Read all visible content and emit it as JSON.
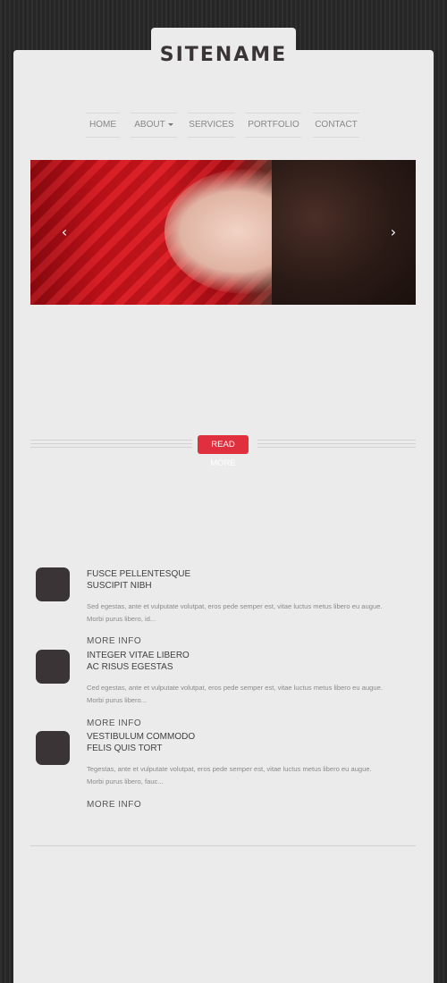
{
  "site": {
    "name": "SITENAME"
  },
  "nav": {
    "items": [
      {
        "label": "HOME"
      },
      {
        "label": "ABOUT"
      },
      {
        "label": "SERVICES"
      },
      {
        "label": "PORTFOLIO"
      },
      {
        "label": "CONTACT"
      }
    ]
  },
  "slider": {
    "prev_icon": "‹",
    "next_icon": "›"
  },
  "cta": {
    "label": "READ MORE"
  },
  "features": [
    {
      "title_line1": "FUSCE PELLENTESQUE",
      "title_line2": "SUSCIPIT NIBH",
      "text_line1": "Sed egestas, ante et vulputate volutpat, eros pede semper est, vitae luctus metus libero eu augue.",
      "text_line2": "Morbi purus libero, id...",
      "more": "MORE INFO"
    },
    {
      "title_line1": "INTEGER VITAE LIBERO",
      "title_line2": "AC RISUS EGESTAS",
      "text_line1": "Ced egestas, ante et vulputate volutpat, eros pede semper est, vitae luctus metus libero eu augue.",
      "text_line2": "Morbi purus libero...",
      "more": "MORE INFO"
    },
    {
      "title_line1": "VESTIBULUM COMMODO",
      "title_line2": "FELIS QUIS TORT",
      "text_line1": "Tegestas, ante et vulputate volutpat, eros pede semper est, vitae luctus metus libero eu augue.",
      "text_line2": "Morbi purus libero, fauc...",
      "more": "MORE INFO"
    }
  ],
  "colors": {
    "accent": "#e0303e",
    "icon_bg": "#3a3436",
    "panel": "#ebebeb"
  }
}
